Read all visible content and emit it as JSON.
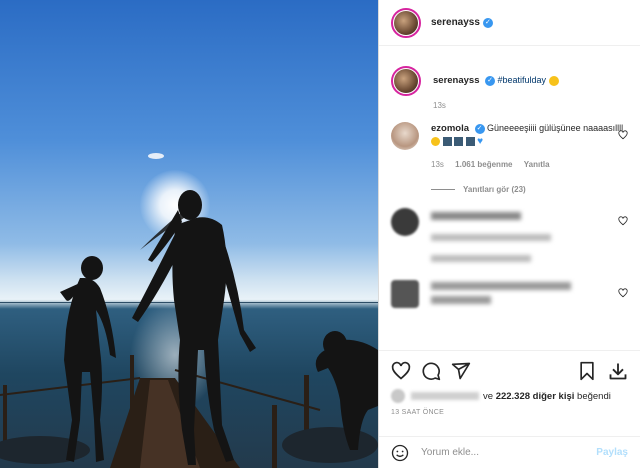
{
  "post": {
    "username": "serenayss",
    "caption_hashtag": "#beatifulday",
    "caption_time": "13s"
  },
  "comments": [
    {
      "username": "ezomola",
      "text": "Güneeeeşiiii gülüşünee naaaasıllll",
      "time": "13s",
      "likes": "1.061 beğenme",
      "reply": "Yanıtla",
      "view_replies": "Yanıtları gör (23)"
    }
  ],
  "likes": {
    "prefix": "ve",
    "count_text": "222.328 diğer kişi",
    "suffix": "beğendi"
  },
  "timestamp": "13 SAAT ÖNCE",
  "add_comment": {
    "placeholder": "Yorum ekle...",
    "post_label": "Paylaş"
  },
  "colors": {
    "verified": "#3897f0",
    "link": "#00376b",
    "story_ring": "#d6249f"
  },
  "icons": [
    "verified-icon",
    "heart-icon",
    "comment-icon",
    "share-icon",
    "bookmark-icon",
    "download-icon",
    "emoji-icon"
  ]
}
